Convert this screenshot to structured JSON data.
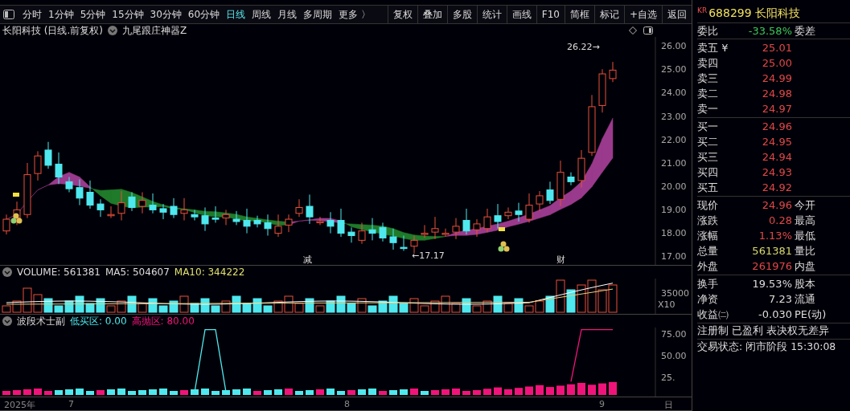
{
  "toolbar": {
    "periods": [
      {
        "label": "分时",
        "selected": false
      },
      {
        "label": "1分钟",
        "selected": false
      },
      {
        "label": "5分钟",
        "selected": false
      },
      {
        "label": "15分钟",
        "selected": false
      },
      {
        "label": "30分钟",
        "selected": false
      },
      {
        "label": "60分钟",
        "selected": false
      },
      {
        "label": "日线",
        "selected": true
      },
      {
        "label": "周线",
        "selected": false
      },
      {
        "label": "月线",
        "selected": false
      },
      {
        "label": "多周期",
        "selected": false
      },
      {
        "label": "更多 〉",
        "selected": false
      }
    ],
    "actions": [
      "复权",
      "叠加",
      "多股",
      "统计",
      "画线",
      "F10",
      "简框",
      "标记",
      "+自选",
      "返回"
    ]
  },
  "main_chart": {
    "title": "长阳科技 (日线.前复权)",
    "indicator": "九尾跟庄神器Z",
    "price_ticks": [
      "26.00",
      "25.00",
      "24.00",
      "23.00",
      "22.00",
      "21.00",
      "20.00",
      "19.00",
      "18.00",
      "17.00"
    ],
    "high_label": "26.22→",
    "low_label": "←17.17",
    "markers": [
      "减",
      "财"
    ]
  },
  "volume": {
    "label": "VOLUME: 561381",
    "ma5": "MA5: 504607",
    "ma10": "MA10: 344222",
    "axis_label": "35000",
    "scale": "X10"
  },
  "oscillator": {
    "title": "波段术士副",
    "low_zone": "低买区: 0.00",
    "high_zone": "高抛区: 80.00",
    "ticks": [
      "75.00",
      "50.00",
      "25."
    ]
  },
  "dates": [
    "2025年",
    "7",
    "8",
    "9"
  ],
  "period_label": "日",
  "quote": {
    "badge": "KR",
    "title": "688299 长阳科技",
    "ratio": {
      "label": "委比",
      "value": "-33.58%",
      "label2": "委差"
    },
    "asks": [
      {
        "label": "卖五 ¥",
        "price": "25.01"
      },
      {
        "label": "卖四",
        "price": "25.00"
      },
      {
        "label": "卖三",
        "price": "24.99"
      },
      {
        "label": "卖二",
        "price": "24.98"
      },
      {
        "label": "卖一",
        "price": "24.97"
      }
    ],
    "bids": [
      {
        "label": "买一",
        "price": "24.96"
      },
      {
        "label": "买二",
        "price": "24.95"
      },
      {
        "label": "买三",
        "price": "24.94"
      },
      {
        "label": "买四",
        "price": "24.93"
      },
      {
        "label": "买五",
        "price": "24.92"
      }
    ],
    "stats": [
      {
        "label": "现价",
        "value": "24.96",
        "color": "#e04848",
        "label2": "今开"
      },
      {
        "label": "涨跌",
        "value": "0.28",
        "color": "#e04848",
        "label2": "最高"
      },
      {
        "label": "涨幅",
        "value": "1.13%",
        "color": "#e04848",
        "label2": "最低"
      },
      {
        "label": "总量",
        "value": "561381",
        "color": "#d8d870",
        "label2": "量比"
      },
      {
        "label": "外盘",
        "value": "261976",
        "color": "#e04848",
        "label2": "内盘"
      }
    ],
    "stats2": [
      {
        "label": "换手",
        "value": "19.53%",
        "color": "#dddddd",
        "label2": "股本"
      },
      {
        "label": "净资",
        "value": "7.23",
        "color": "#dddddd",
        "label2": "流通"
      },
      {
        "label": "收益㈡",
        "value": "-0.030",
        "color": "#dddddd",
        "label2": "PE(动)"
      }
    ],
    "tags": "注册制 已盈利 表决权无差异",
    "status": "交易状态: 闭市阶段 15:30:08"
  }
}
